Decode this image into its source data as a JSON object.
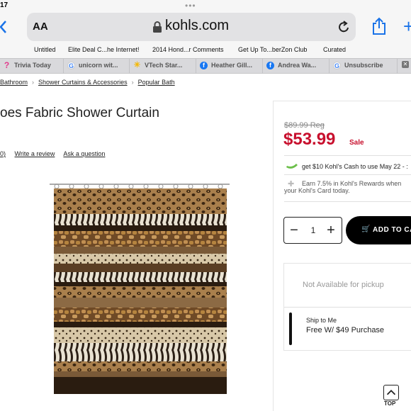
{
  "status": {
    "time": "17"
  },
  "browser": {
    "text_size_label": "AA",
    "url": "kohls.com",
    "bookmarks": [
      "Untitled",
      "Elite Deal C...he Internet!",
      "2014 Hond...r Comments",
      "Get Up To...berZon Club",
      "Curated"
    ],
    "tabs": [
      {
        "label": "Trivia Today",
        "icon": "question-icon"
      },
      {
        "label": "unicorn wit...",
        "icon": "google-icon"
      },
      {
        "label": "VTech Star...",
        "icon": "walmart-icon"
      },
      {
        "label": "Heather Gill...",
        "icon": "facebook-icon"
      },
      {
        "label": "Andrea Wa...",
        "icon": "facebook-icon"
      },
      {
        "label": "Unsubscribe",
        "icon": "google-icon"
      }
    ]
  },
  "breadcrumb": [
    "Bathroom",
    "Shower Curtains & Accessories",
    "Popular Bath"
  ],
  "product": {
    "title": "oes Fabric Shower Curtain",
    "review_count": "0)",
    "write_review": "Write a review",
    "ask_question": "Ask a question"
  },
  "pricing": {
    "regular": "$89.99 Reg",
    "sale_price": "$53.99",
    "sale_label": "Sale",
    "kohls_cash": "get $10 Kohl's Cash to use May 22 - :",
    "rewards_line1": "Earn 7.5% in Kohl's Rewards when",
    "rewards_line2": "your Kohl's Card today."
  },
  "cart": {
    "quantity": "1",
    "add_to_cart": "ADD TO CA"
  },
  "fulfillment": {
    "pickup": "Not Available for pickup",
    "ship_label": "Ship to Me",
    "ship_value": "Free W/ $49 Purchase"
  },
  "top_button": "TOP",
  "colors": {
    "sale_red": "#c8102e",
    "link_blue": "#1a73e8"
  }
}
